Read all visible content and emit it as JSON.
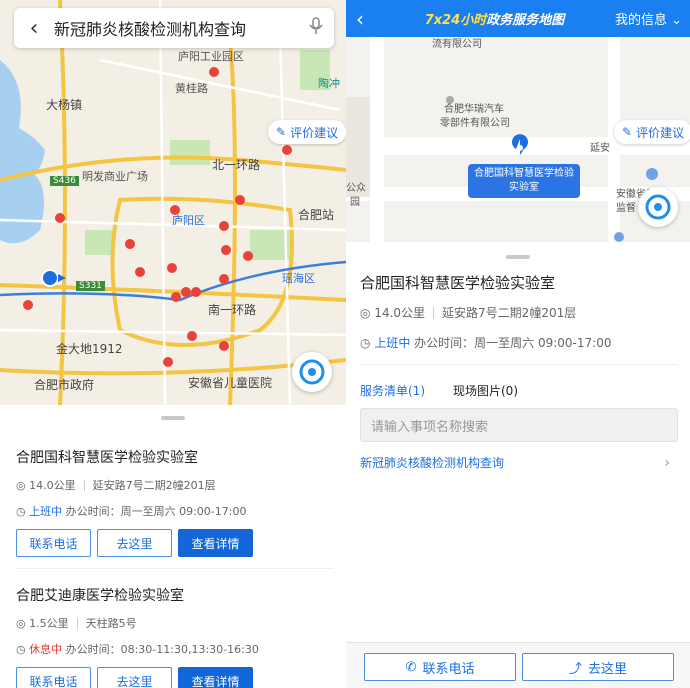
{
  "left": {
    "search_query": "新冠肺炎核酸检测机构查询",
    "eval_label": "评价建议",
    "map_labels": {
      "luzhou": "庐阳工业园区",
      "dayangzhen": "大杨镇",
      "huangkou": "黄桂路",
      "taoding": "陶冲",
      "mingfa": "明发商业广场",
      "beiyihuanlu": "北一环路",
      "s436": "S436",
      "luyangqu": "庐阳区",
      "hefeizhan": "合肥站",
      "s331": "S331",
      "yaohaiqu": "瑶海区",
      "nanyihuanlu": "南一环路",
      "jinda": "金大地1912",
      "hefeishizhengfu": "合肥市政府",
      "ertong": "安徽省儿童医院"
    },
    "cards": [
      {
        "name": "合肥国科智慧医学检验实验室",
        "distance": "14.0公里",
        "address": "延安路7号二期2幢201层",
        "status": "上班中",
        "hours": "办公时间：周一至周六 09:00-17:00",
        "btn_phone": "联系电话",
        "btn_go": "去这里",
        "btn_detail": "查看详情"
      },
      {
        "name": "合肥艾迪康医学检验实验室",
        "distance": "1.5公里",
        "address": "天柱路5号",
        "status": "休息中",
        "hours": "办公时间：08:30-11:30,13:30-16:30",
        "btn_phone": "联系电话",
        "btn_go": "去这里",
        "btn_detail": "查看详情"
      }
    ]
  },
  "right": {
    "header_title_hl": "7x24小时",
    "header_title": "政务服务地图",
    "header_mine": "我的信息",
    "map_labels": {
      "top": "流有限公司",
      "huarui": "合肥华瑞汽车",
      "huarui2": "零部件有限公司",
      "yanan": "延安",
      "gongzhong": "公众",
      "yuan": "园",
      "zhiliang": "安徽省质量",
      "jiandu": "监督"
    },
    "eval_label": "评价建议",
    "bubble_line1": "合肥国科智慧医学检验",
    "bubble_line2": "实验室",
    "name": "合肥国科智慧医学检验实验室",
    "distance": "14.0公里",
    "address": "延安路7号二期2幢201层",
    "status": "上班中",
    "hours": "办公时间：周一至周六 09:00-17:00",
    "tab_services": "服务清单(1)",
    "tab_photos": "现场图片(0)",
    "search_placeholder": "请输入事项名称搜索",
    "service_link": "新冠肺炎核酸检测机构查询",
    "btn_phone": "联系电话",
    "btn_go": "去这里"
  },
  "colors": {
    "accent": "#1266d8",
    "header": "#1a7ff0",
    "pin": "#e8433a",
    "rest": "#e5322d"
  },
  "icons": [
    "back-icon",
    "mic-icon",
    "pin-icon",
    "location-icon",
    "clock-icon",
    "phone-icon",
    "navigate-icon",
    "chevron-right-icon",
    "brush-icon",
    "compass-icon"
  ]
}
